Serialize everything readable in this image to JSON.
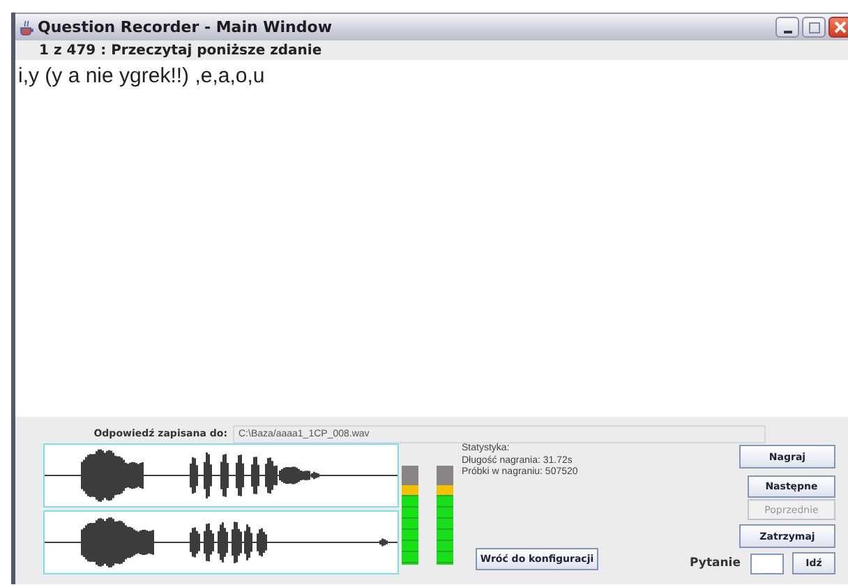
{
  "window": {
    "title": "Question Recorder - Main Window"
  },
  "header": "1 z 479 : Przeczytaj poniższe zdanie",
  "sentence": "i,y (y a nie ygrek!!) ,e,a,o,u",
  "output": {
    "label": "Odpowiedź zapisana do:",
    "value": "C:\\Baza/aaaa1_1CP_008.wav"
  },
  "meters": [
    {
      "level": 0.8
    },
    {
      "level": 0.8
    }
  ],
  "stats": [
    "Statystyka:",
    "Długość nagrania: 31.72s",
    "Próbki w nagraniu: 507520"
  ],
  "buttons": [
    {
      "label": "Nagraj",
      "disabled": false
    },
    {
      "label": "Następne",
      "disabled": false
    },
    {
      "label": "Poprzednie",
      "disabled": true
    },
    {
      "label": "Zatrzymaj",
      "disabled": false
    }
  ],
  "config_button": "Wróć do konfiguracji",
  "goto": {
    "label": "Pytanie",
    "button": "Idź"
  }
}
